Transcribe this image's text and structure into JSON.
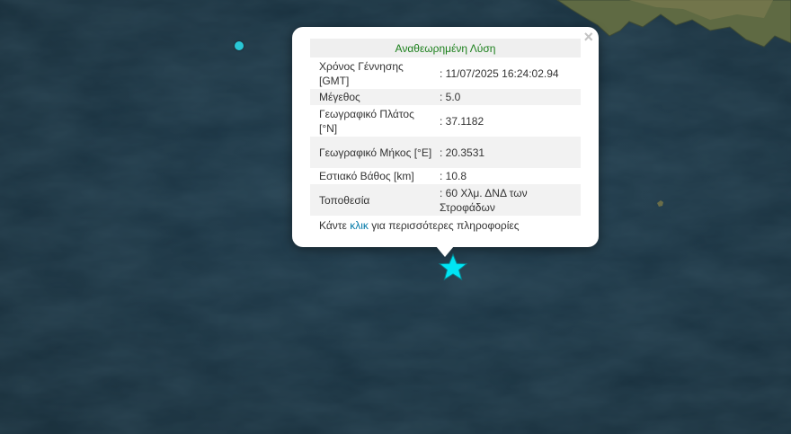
{
  "map": {
    "colors": {
      "sea": "#1b3545",
      "sea_dark": "#152c39",
      "land": "#6b6f45"
    }
  },
  "popup": {
    "title": "Αναθεωρημένη Λύση",
    "close_symbol": "×",
    "rows": [
      {
        "label": "Χρόνος Γέννησης [GMT]",
        "value": ": 11/07/2025 16:24:02.94"
      },
      {
        "label": "Μέγεθος",
        "value": ": 5.0"
      },
      {
        "label": "Γεωγραφικό Πλάτος [°N]",
        "value": ": 37.1182"
      },
      {
        "label": "Γεωγραφικό Μήκος [°E]",
        "value": ": 20.3531"
      },
      {
        "label": "Εστιακό Βάθος [km]",
        "value": ": 10.8"
      },
      {
        "label": "Τοποθεσία",
        "value": ": 60 Χλμ. ΔΝΔ των Στροφάδων"
      }
    ],
    "more_prefix": "Κάντε",
    "more_link": "κλικ",
    "more_suffix": "για περισσότερες πληροφορίες"
  },
  "markers": {
    "epicenter_icon": "star-icon",
    "epicenter_color": "#00e5f5",
    "other_event_color": "#29c7d6"
  }
}
